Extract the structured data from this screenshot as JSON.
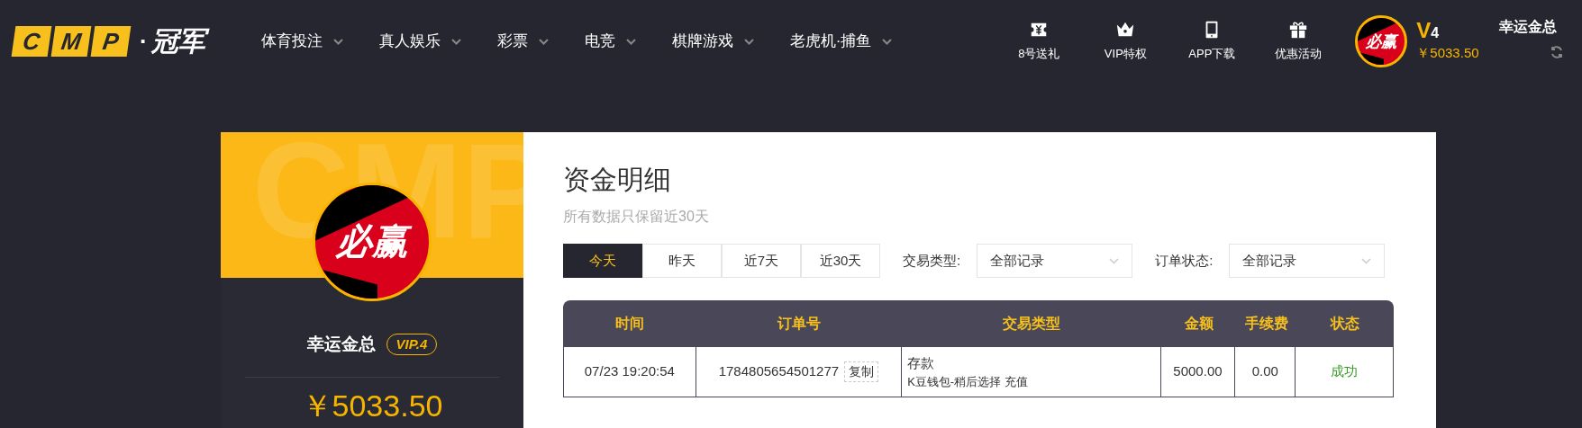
{
  "header": {
    "logo": {
      "letters": [
        "C",
        "M",
        "P"
      ],
      "dot": "·",
      "name": "冠军"
    },
    "nav": [
      {
        "label": "体育投注"
      },
      {
        "label": "真人娱乐"
      },
      {
        "label": "彩票"
      },
      {
        "label": "电竞"
      },
      {
        "label": "棋牌游戏"
      },
      {
        "label": "老虎机·捕鱼"
      }
    ],
    "shortcuts": [
      {
        "kind": "ticket",
        "label": "8号送礼"
      },
      {
        "kind": "crown",
        "label": "VIP特权"
      },
      {
        "kind": "tablet",
        "label": "APP下载"
      },
      {
        "kind": "gift",
        "label": "优惠活动"
      }
    ],
    "user": {
      "avatar_text": "必赢",
      "vip": "V",
      "vip_level": "4",
      "balance": "￥5033.50",
      "name": "幸运金总"
    }
  },
  "profile": {
    "watermark": "CMP",
    "avatar_text": "必赢",
    "name": "幸运金总",
    "vip_badge": "VIP.4",
    "balance": "￥5033.50"
  },
  "content": {
    "title": "资金明细",
    "subtitle": "所有数据只保留近30天",
    "tabs": [
      {
        "label": "今天",
        "selected": true
      },
      {
        "label": "昨天",
        "selected": false
      },
      {
        "label": "近7天",
        "selected": false
      },
      {
        "label": "近30天",
        "selected": false
      }
    ],
    "filters": [
      {
        "label": "交易类型:",
        "value": "全部记录"
      },
      {
        "label": "订单状态:",
        "value": "全部记录"
      }
    ],
    "table": {
      "columns": [
        "时间",
        "订单号",
        "交易类型",
        "金额",
        "手续费",
        "状态"
      ],
      "rows": [
        {
          "time": "07/23 19:20:54",
          "order": "1784805654501277",
          "copy": "复制",
          "type": "存款",
          "detail": "K豆钱包-稍后选择 充值",
          "amount": "5000.00",
          "fee": "0.00",
          "status": "成功",
          "success": true
        }
      ]
    }
  }
}
